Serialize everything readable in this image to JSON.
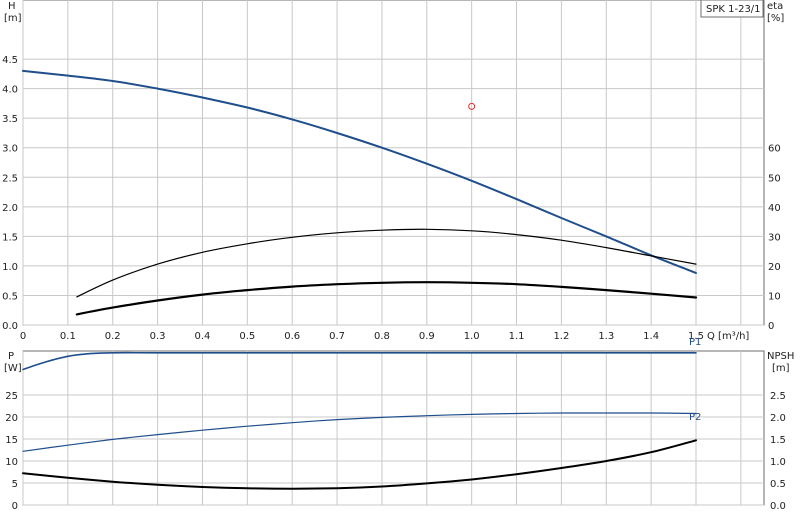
{
  "chart_data": [
    {
      "type": "line",
      "panel": "top",
      "legend_box": "SPK 1-23/1",
      "x_axis": {
        "label": "Q [m³/h]",
        "range": [
          0,
          1.5
        ],
        "ticks": [
          "0",
          "0.1",
          "0.2",
          "0.3",
          "0.4",
          "0.5",
          "0.6",
          "0.7",
          "0.8",
          "0.9",
          "1.0",
          "1.1",
          "1.2",
          "1.3",
          "1.4",
          "1.5"
        ],
        "tick_values": [
          0,
          0.1,
          0.2,
          0.3,
          0.4,
          0.5,
          0.6,
          0.7,
          0.8,
          0.9,
          1.0,
          1.1,
          1.2,
          1.3,
          1.4,
          1.5
        ]
      },
      "y_left": {
        "label_line1": "H",
        "label_line2": "[m]",
        "range": [
          0,
          5.5
        ],
        "ticks": [
          "0.0",
          "0.5",
          "1.0",
          "1.5",
          "2.0",
          "2.5",
          "3.0",
          "3.5",
          "4.0",
          "4.5"
        ],
        "tick_values": [
          0,
          0.5,
          1.0,
          1.5,
          2.0,
          2.5,
          3.0,
          3.5,
          4.0,
          4.5
        ]
      },
      "y_right": {
        "label_line1": "eta",
        "label_line2": "[%]",
        "range": [
          0,
          110
        ],
        "ticks": [
          "0",
          "10",
          "20",
          "30",
          "40",
          "50",
          "60"
        ],
        "tick_values": [
          0,
          10,
          20,
          30,
          40,
          50,
          60
        ]
      },
      "grid": true,
      "series": [
        {
          "axis": "left",
          "color": "#1f4e8c",
          "width": 2,
          "x": [
            0,
            0.1,
            0.2,
            0.3,
            0.4,
            0.5,
            0.6,
            0.7,
            0.8,
            0.9,
            1.0,
            1.1,
            1.2,
            1.3,
            1.4,
            1.5
          ],
          "y": [
            4.3,
            4.22,
            4.13,
            4.0,
            3.85,
            3.68,
            3.48,
            3.25,
            3.0,
            2.73,
            2.44,
            2.13,
            1.81,
            1.5,
            1.18,
            0.88
          ]
        },
        {
          "axis": "right",
          "color": "#000000",
          "width": 1.2,
          "x": [
            0.12,
            0.2,
            0.3,
            0.4,
            0.5,
            0.6,
            0.7,
            0.8,
            0.9,
            1.0,
            1.1,
            1.2,
            1.3,
            1.4,
            1.5
          ],
          "y": [
            9.5,
            15.2,
            20.6,
            24.6,
            27.5,
            29.7,
            31.2,
            32.1,
            32.4,
            31.9,
            30.6,
            28.7,
            26.2,
            23.4,
            20.6
          ]
        },
        {
          "axis": "right",
          "color": "#000000",
          "width": 2.2,
          "x": [
            0.12,
            0.2,
            0.3,
            0.4,
            0.5,
            0.6,
            0.7,
            0.8,
            0.9,
            1.0,
            1.1,
            1.2,
            1.3,
            1.4,
            1.5
          ],
          "y": [
            3.6,
            5.9,
            8.3,
            10.3,
            11.8,
            13.0,
            13.8,
            14.3,
            14.5,
            14.3,
            13.8,
            12.9,
            11.8,
            10.6,
            9.3
          ]
        }
      ],
      "annotations": [
        {
          "type": "circle",
          "x": 1.0,
          "y": 3.7,
          "color": "#e03030"
        }
      ]
    },
    {
      "type": "line",
      "panel": "bottom",
      "x_axis": {
        "range": [
          0,
          1.5
        ]
      },
      "y_left": {
        "label_line1": "P",
        "label_line2": "[W]",
        "range": [
          0,
          35
        ],
        "ticks": [
          "0",
          "5",
          "10",
          "15",
          "20",
          "25"
        ],
        "tick_values": [
          0,
          5,
          10,
          15,
          20,
          25
        ]
      },
      "y_right": {
        "label_line1": "NPSH",
        "label_line2": "[m]",
        "range": [
          0,
          3.5
        ],
        "ticks": [
          "0.0",
          "0.5",
          "1.0",
          "1.5",
          "2.0",
          "2.5"
        ],
        "tick_values": [
          0,
          0.5,
          1.0,
          1.5,
          2.0,
          2.5
        ]
      },
      "grid": true,
      "series": [
        {
          "name": "P1",
          "axis": "left",
          "color": "#1f4e8c",
          "width": 1.6,
          "x": [
            0,
            0.05,
            0.1,
            0.15,
            0.2,
            0.3,
            0.5,
            0.8,
            1.0,
            1.2,
            1.5
          ],
          "y": [
            30.8,
            32.5,
            33.8,
            34.4,
            34.6,
            34.6,
            34.6,
            34.6,
            34.6,
            34.6,
            34.6
          ]
        },
        {
          "name": "P2",
          "axis": "left",
          "color": "#1f4e8c",
          "width": 1.2,
          "x": [
            0,
            0.1,
            0.2,
            0.3,
            0.4,
            0.5,
            0.6,
            0.7,
            0.8,
            0.9,
            1.0,
            1.1,
            1.2,
            1.3,
            1.4,
            1.5
          ],
          "y": [
            12.2,
            13.6,
            14.9,
            16.0,
            17.0,
            17.9,
            18.7,
            19.4,
            19.9,
            20.3,
            20.6,
            20.8,
            20.9,
            20.9,
            20.9,
            20.8
          ]
        },
        {
          "axis": "right",
          "color": "#000000",
          "width": 2,
          "x": [
            0,
            0.1,
            0.2,
            0.3,
            0.4,
            0.5,
            0.6,
            0.7,
            0.8,
            0.9,
            1.0,
            1.1,
            1.2,
            1.3,
            1.4,
            1.5
          ],
          "y": [
            0.72,
            0.62,
            0.53,
            0.46,
            0.41,
            0.38,
            0.37,
            0.38,
            0.42,
            0.49,
            0.58,
            0.7,
            0.84,
            1.0,
            1.2,
            1.47
          ]
        }
      ]
    }
  ]
}
